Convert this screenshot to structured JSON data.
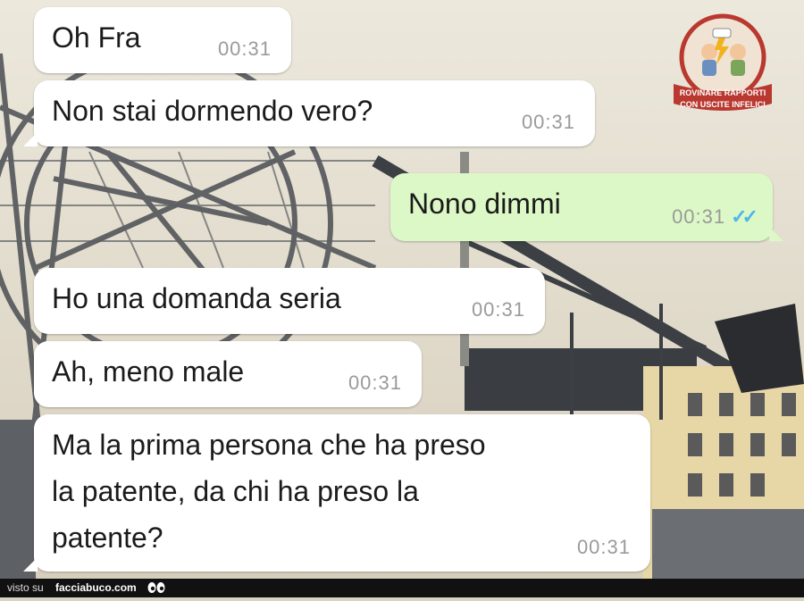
{
  "messages": [
    {
      "text": "Oh Fra",
      "time": "00:31",
      "direction": "incoming"
    },
    {
      "text": "Non stai dormendo vero?",
      "time": "00:31",
      "direction": "incoming"
    },
    {
      "text": "Nono dimmi",
      "time": "00:31",
      "direction": "outgoing",
      "status": "read"
    },
    {
      "text": "Ho una domanda seria",
      "time": "00:31",
      "direction": "incoming"
    },
    {
      "text": "Ah, meno male",
      "time": "00:31",
      "direction": "incoming"
    },
    {
      "text_lines": [
        "Ma la prima persona che ha preso",
        "la patente, da chi ha preso la",
        "patente?"
      ],
      "time": "00:31",
      "direction": "incoming"
    }
  ],
  "badge": {
    "line1": "ROVINARE RAPPORTI",
    "line2": "CON USCITE INFELICI"
  },
  "footer": {
    "prefix": "visto su",
    "site": "facciabuco.com",
    "icon": "eyes-icon"
  },
  "colors": {
    "incoming": "#ffffff",
    "outgoing": "#dcf8c6",
    "read_ticks": "#4fb6ec",
    "time": "#9a9a9a"
  }
}
